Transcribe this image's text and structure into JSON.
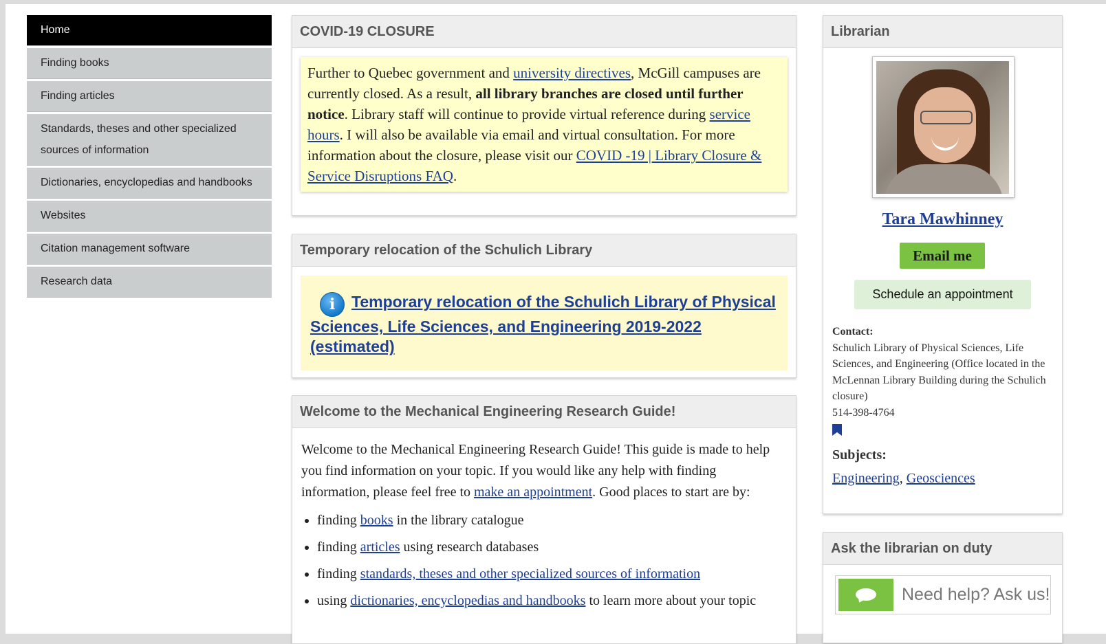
{
  "nav": {
    "items": [
      {
        "label": "Home",
        "active": true
      },
      {
        "label": "Finding books"
      },
      {
        "label": "Finding articles"
      },
      {
        "label": "Standards, theses and other specialized sources of information"
      },
      {
        "label": "Dictionaries, encyclopedias and handbooks"
      },
      {
        "label": "Websites"
      },
      {
        "label": "Citation management software"
      },
      {
        "label": "Research data"
      }
    ]
  },
  "closure": {
    "title": "COVID-19 CLOSURE",
    "p1": "Further to Quebec government and ",
    "link_directives": "university directives",
    "p2": ", McGill campuses are currently closed. As a result, ",
    "bold": "all library branches are closed until further notice",
    "p3": ". Library staff will continue to provide virtual reference during ",
    "link_hours": "service hours",
    "p4": ". I will also be available via email and virtual consultation. For more information about the closure, please visit our ",
    "link_faq": "COVID -19 | Library Closure & Service Disruptions FAQ",
    "p5": "."
  },
  "relocation": {
    "title": "Temporary relocation of the Schulich Library",
    "icon": "info-icon",
    "link": "Temporary relocation of the Schulich Library of Physical Sciences, Life Sciences, and Engineering 2019-2022 (estimated)"
  },
  "welcome": {
    "title": "Welcome to the Mechanical Engineering Research Guide!",
    "intro1": "Welcome to the Mechanical Engineering Research Guide! This guide is made to help you find information on your topic. If you would like any help with finding information, please feel free to ",
    "intro_link": "make an appointment",
    "intro2": ". Good places to start are by:",
    "bullets": [
      {
        "pre": "finding ",
        "link": "books",
        "post": " in the library catalogue"
      },
      {
        "pre": "finding ",
        "link": "articles",
        "post": " using research databases"
      },
      {
        "pre": "finding ",
        "link": "standards, theses and other specialized sources of information",
        "post": ""
      },
      {
        "pre": "using ",
        "link": "dictionaries, encyclopedias and handbooks",
        "post": " to learn more about your topic"
      }
    ]
  },
  "librarian": {
    "title": "Librarian",
    "name": "Tara Mawhinney",
    "email_btn": "Email me",
    "schedule_btn": "Schedule an appointment",
    "contact_label": "Contact:",
    "contact_text": "Schulich Library of Physical Sciences, Life Sciences, and Engineering (Office located in the McLennan Library Building during the Schulich closure)",
    "phone": "514-398-4764",
    "subjects_label": "Subjects:",
    "subject1": "Engineering",
    "subject_sep": ", ",
    "subject2": "Geosciences"
  },
  "ask": {
    "title": "Ask the librarian on duty",
    "widget_text": "Need help? Ask us!"
  },
  "colors": {
    "accent_green": "#7cc242",
    "link_blue": "#1e3f96",
    "nav_active": "#000000",
    "nav_bg": "#c9cdcd"
  }
}
